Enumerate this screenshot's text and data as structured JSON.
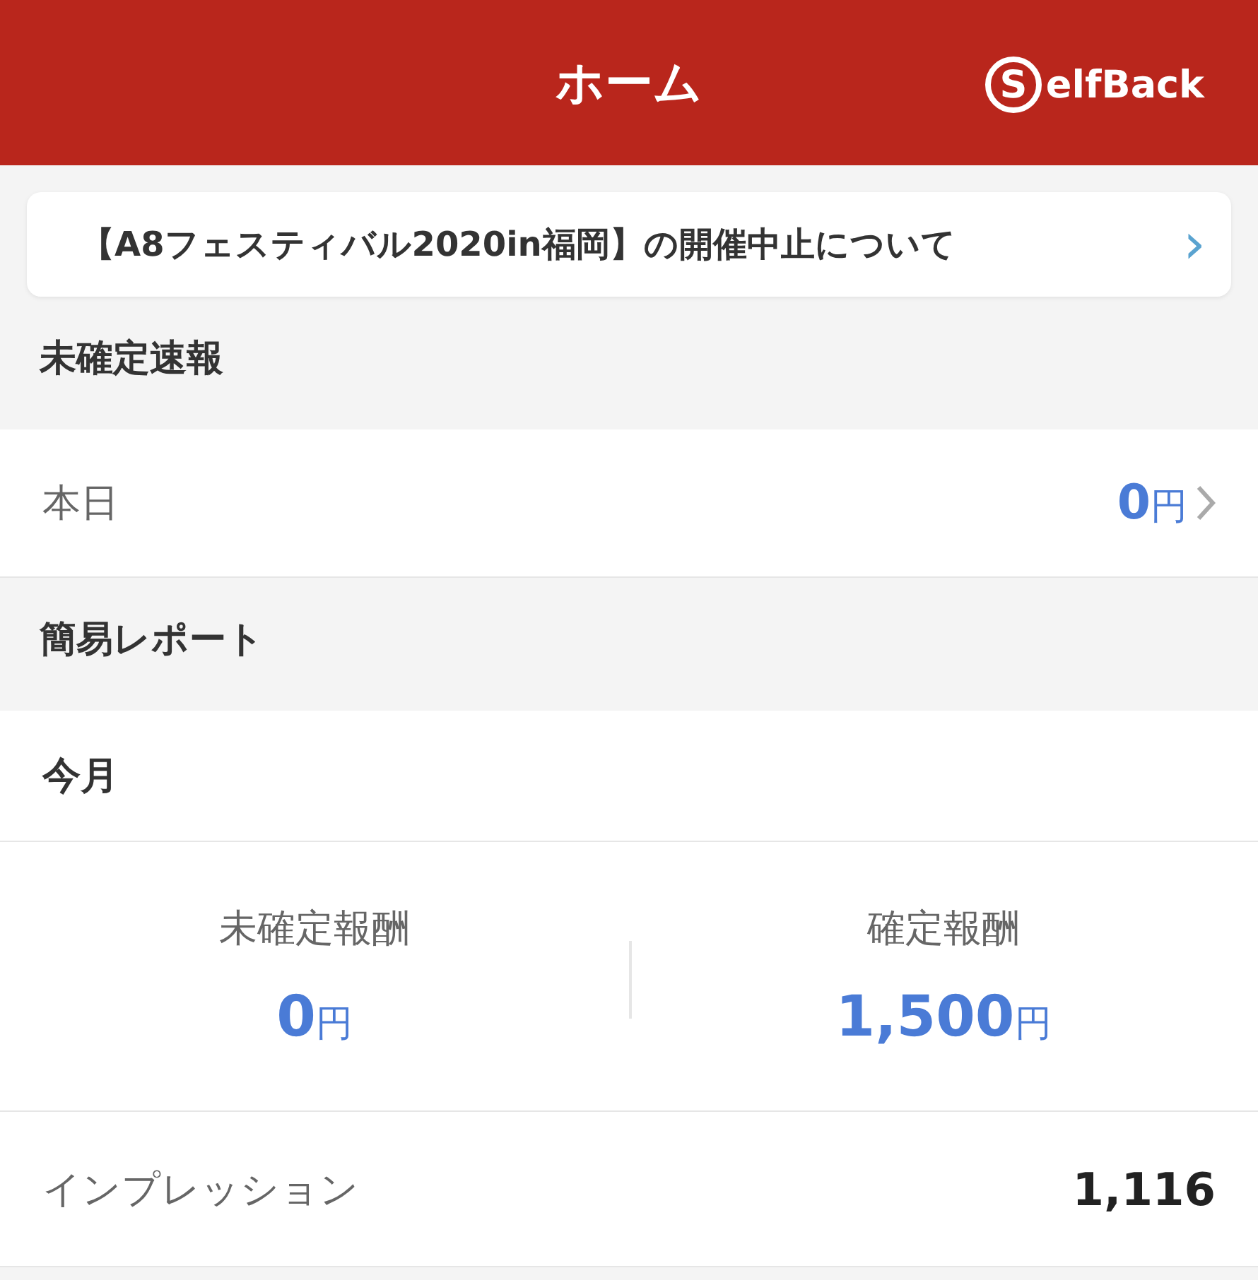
{
  "header": {
    "title": "ホーム",
    "logo": {
      "mark": "S",
      "text": "elfBack"
    }
  },
  "notice": {
    "text": "【A8フェスティバル2020in福岡】の開催中止について",
    "chevron": "›"
  },
  "sections": [
    {
      "title": "未確定速報",
      "rows": [
        {
          "kind": "link",
          "label": "本日",
          "value": "0",
          "unit": "円"
        }
      ]
    },
    {
      "title": "簡易レポート",
      "rows": [
        {
          "kind": "subheading",
          "label": "今月"
        },
        {
          "kind": "stats",
          "items": [
            {
              "label": "未確定報酬",
              "value": "0",
              "unit": "円"
            },
            {
              "label": "確定報酬",
              "value": "1,500",
              "unit": "円"
            }
          ]
        },
        {
          "kind": "plain",
          "label": "インプレッション",
          "value": "1,116"
        }
      ]
    }
  ]
}
